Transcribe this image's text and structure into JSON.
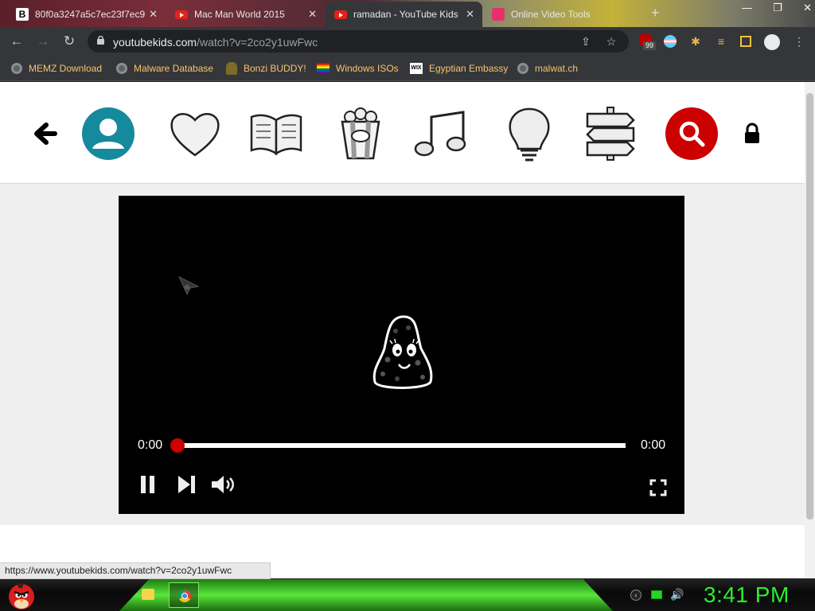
{
  "browser": {
    "tabs": [
      {
        "title": "80f0a3247a5c7ec23f7ec9",
        "favicon": "b-icon"
      },
      {
        "title": "Mac Man World 2015",
        "favicon": "youtube-icon"
      },
      {
        "title": "ramadan - YouTube Kids",
        "favicon": "youtube-icon",
        "active": true
      },
      {
        "title": "Online Video Tools",
        "favicon": "pink-icon"
      }
    ],
    "url_host": "youtubekids.com",
    "url_path": "/watch?v=2co2y1uwFwc",
    "extension_badge": "99",
    "bookmarks": [
      {
        "label": "MEMZ Download"
      },
      {
        "label": "Malware Database"
      },
      {
        "label": "Bonzi BUDDY!"
      },
      {
        "label": "Windows ISOs"
      },
      {
        "label": "Egyptian Embassy"
      },
      {
        "label": "malwat.ch"
      }
    ]
  },
  "kids_nav": {
    "items": [
      "back",
      "profile",
      "favorites",
      "books",
      "popcorn",
      "music",
      "idea",
      "explore",
      "search",
      "lock"
    ]
  },
  "player": {
    "current_time": "0:00",
    "duration": "0:00",
    "progress": 0
  },
  "status_bar": {
    "hover_url": "https://www.youtubekids.com/watch?v=2co2y1uwFwc"
  },
  "taskbar": {
    "clock": "3:41 PM"
  },
  "colors": {
    "accent_red": "#cc0000",
    "profile_teal": "#158a9c",
    "clock_green": "#2bef2b"
  }
}
